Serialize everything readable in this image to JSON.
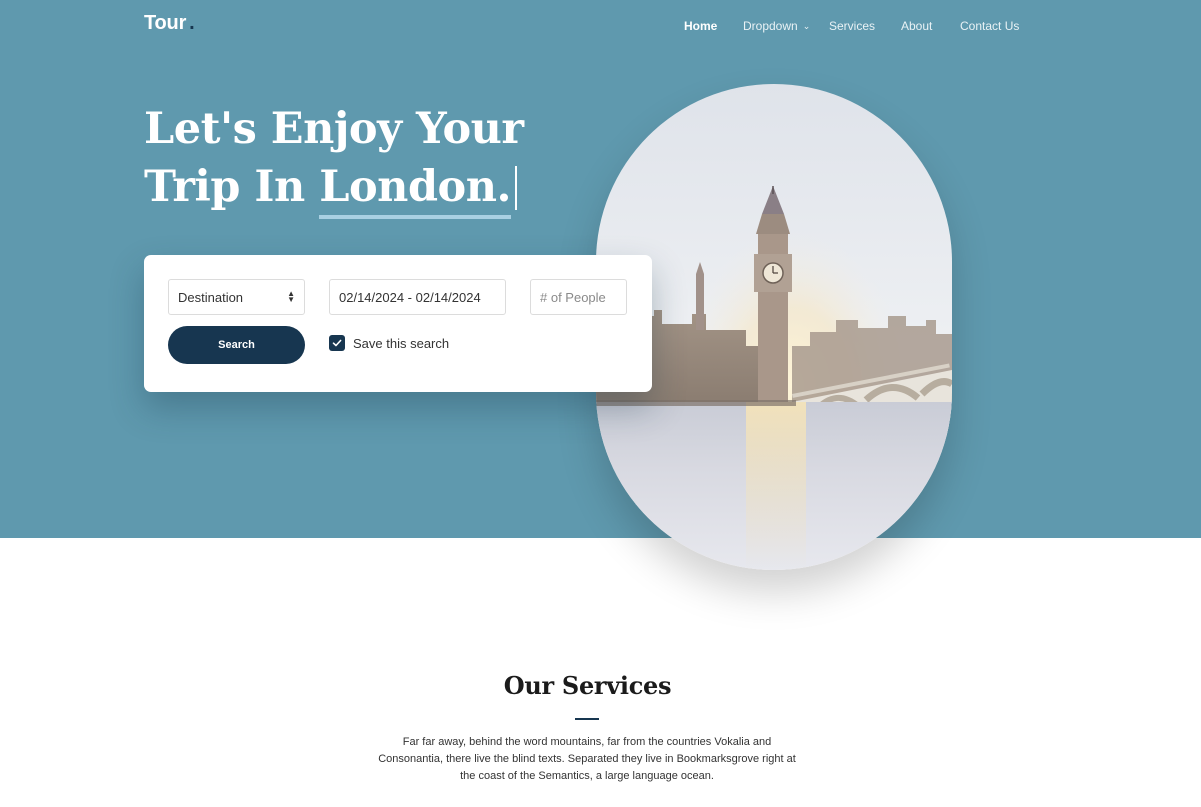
{
  "brand": {
    "name": "Tour",
    "dot": "."
  },
  "nav": {
    "items": [
      {
        "label": "Home",
        "active": true
      },
      {
        "label": "Dropdown",
        "has_chevron": true
      },
      {
        "label": "Services"
      },
      {
        "label": "About"
      },
      {
        "label": "Contact Us"
      }
    ],
    "chevron": "⌄"
  },
  "hero": {
    "line1": "Let's Enjoy Your",
    "line2_prefix": "Trip In",
    "city": "London.",
    "background_color": "#5f99ae",
    "image": {
      "icon": "big-ben-london-photo"
    }
  },
  "search": {
    "destination_select": {
      "value": "Destination"
    },
    "date_range": {
      "value": "02/14/2024 - 02/14/2024"
    },
    "people": {
      "placeholder": "# of People"
    },
    "button_label": "Search",
    "save_checkbox": {
      "label": "Save this search",
      "checked": true
    }
  },
  "services": {
    "title": "Our Services",
    "description": "Far far away, behind the word mountains, far from the countries Vokalia and Consonantia, there live the blind texts. Separated they live in Bookmarksgrove right at the coast of the Semantics, a large language ocean."
  },
  "colors": {
    "accent": "#173650",
    "hero": "#5f99ae",
    "underline": "#a9d0e2"
  }
}
